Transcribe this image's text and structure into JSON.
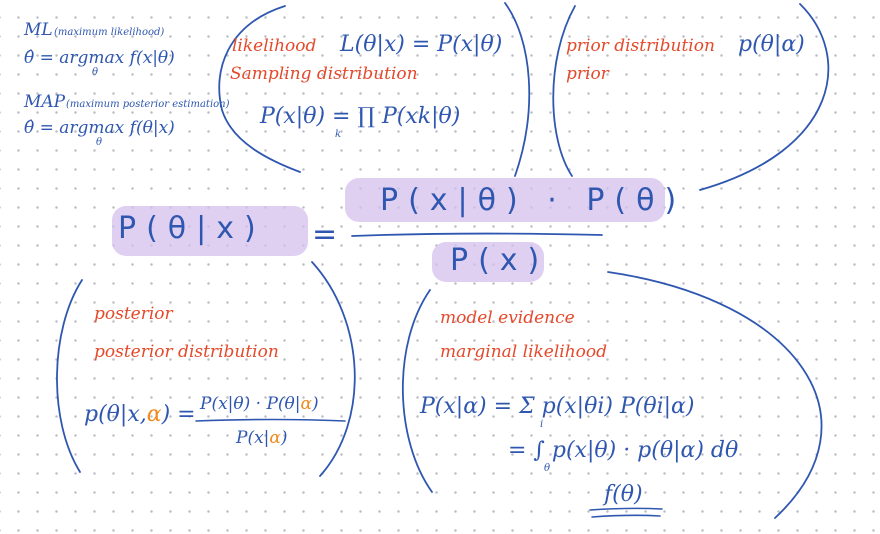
{
  "colors": {
    "ink_blue": "#2f57b0",
    "ink_red": "#e4492b",
    "ink_orange": "#f08a1e",
    "highlight": "#d4c0ee",
    "grid_dot": "#b9bcc4"
  },
  "ml": {
    "title": "ML",
    "subtitle": "(maximum likelihood)",
    "formula": "θ̂ = argmax f(x|θ)",
    "subscript": "θ"
  },
  "map": {
    "title": "MAP",
    "subtitle": "(maximum posterior estimation)",
    "formula": "θ̂ = argmax f(θ|x)",
    "subscript": "θ"
  },
  "likelihood_box": {
    "label1": "likelihood",
    "label1_formula": "L(θ|x) = P(x|θ)",
    "label2": "Sampling distribution",
    "formula": "P(x|θ) = ∏ P(xk|θ)",
    "subscript": "k"
  },
  "prior_box": {
    "label1": "prior distribution",
    "label1_formula": "p(θ|α)",
    "label2": "prior"
  },
  "bayes": {
    "lhs": "P(θ|x)",
    "equals": "=",
    "numerator": "P(x|θ) · P(θ)",
    "denominator": "P(x)"
  },
  "posterior_box": {
    "label1": "posterior",
    "label2": "posterior distribution",
    "formula_lhs_a": "p(θ|x,",
    "formula_lhs_alpha": "α",
    "formula_lhs_b": ") =",
    "formula_num_a": "P(x|θ) · P(θ|",
    "formula_num_alpha": "α",
    "formula_num_b": ")",
    "formula_den_a": "P(x|",
    "formula_den_alpha": "α",
    "formula_den_b": ")"
  },
  "evidence_box": {
    "label1": "model evidence",
    "label2": "marginal likelihood",
    "line1": "P(x|α) = Σ p(x|θi) P(θi|α)",
    "line1_subscript": "i",
    "line2": "= ∫ p(x|θ) · p(θ|α) dθ",
    "line2_subscript": "θ",
    "line3": "f(θ)"
  }
}
